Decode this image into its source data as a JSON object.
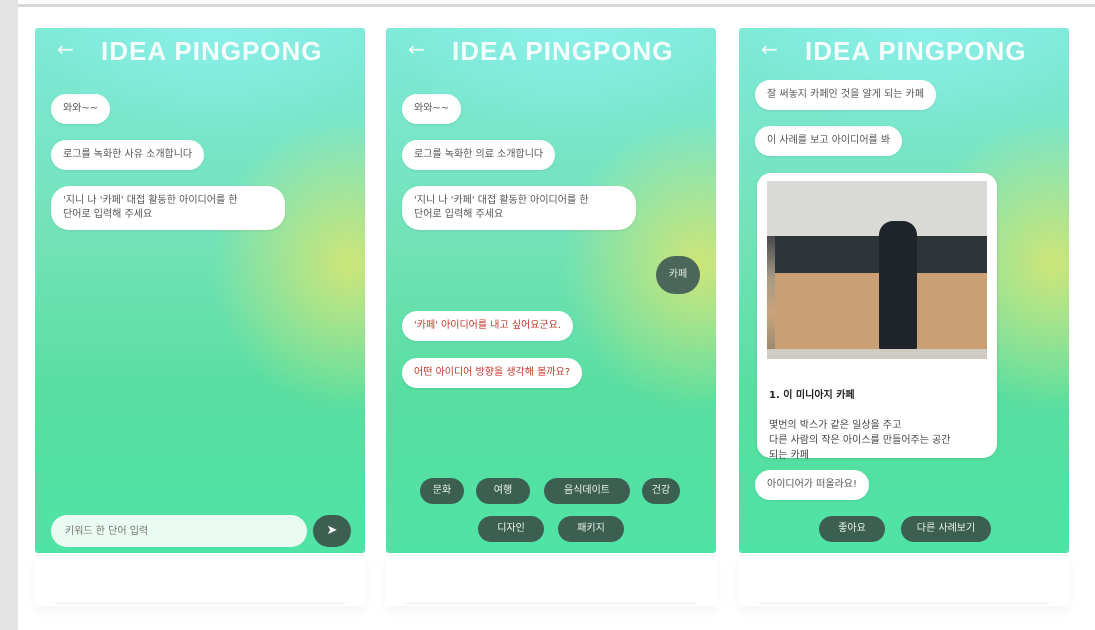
{
  "app_title": "IDEA PINGPONG",
  "back_glyph": "←",
  "screen1": {
    "messages": [
      "와와~~",
      "로그를 녹화한 사유 소개합니다",
      "'지니 나 '카페' 대접 활동한 아이디어를 한\n단어로 입력해 주세요"
    ],
    "input_placeholder": "키워드 한 단어 입력",
    "send_icon": "send-icon"
  },
  "screen2": {
    "messages": [
      "와와~~",
      "로그를 녹화한 의료 소개합니다",
      "'지니 나 '카페' 대접 활동한 아이디어를 한\n단어로 입력해 주세요"
    ],
    "user_reply": "카페",
    "bot_replies": [
      "'카페' 아이디어를 내고 싶어요군요.",
      "어떤 아이디어 방향을 생각해 볼까요?"
    ],
    "options_row1": [
      "문화",
      "여행",
      "음식데이트",
      "건강"
    ],
    "options_row2": [
      "디자인",
      "패키지"
    ]
  },
  "screen3": {
    "messages": [
      "잘 써놓지 카페인 것을 알게 되는 카페",
      "이 사례를 보고 아이디어를 봐"
    ],
    "card": {
      "title": "1. 이 미니아지 카페",
      "body": "몇번의 박스가 같은 일상을 주고\n다른 사람의 작은 아이스를 만들어주는 공간\n되는 카페"
    },
    "final_message": "아이디어가 떠올라요!",
    "buttons": [
      "좋아요",
      "다른 사례보기"
    ]
  }
}
